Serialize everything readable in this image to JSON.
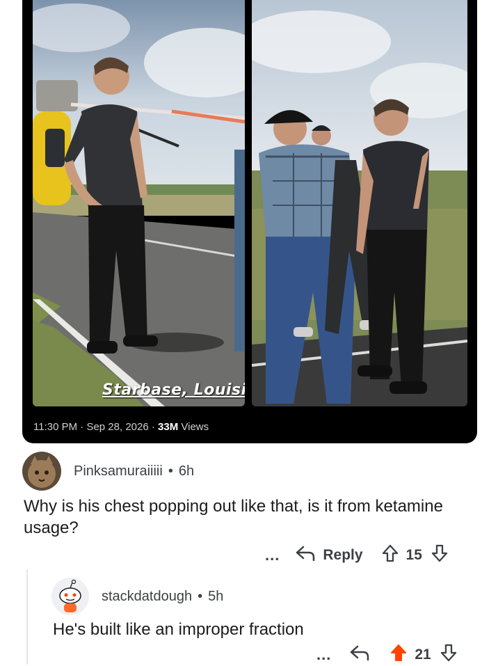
{
  "post": {
    "caption": "Starbase, Louisiana",
    "time": "11:30 PM",
    "sep1": " · ",
    "date": "Sep 28, 2026",
    "sep2": " · ",
    "views_count": "33M",
    "views_label": " Views"
  },
  "comments": [
    {
      "username": "Pinksamuraiiiii",
      "dot": "•",
      "age": "6h",
      "body": "Why is his chest popping out like that, is it from ketamine usage?",
      "more": "...",
      "reply_label": "Reply",
      "votes": "15"
    },
    {
      "username": "stackdatdough",
      "dot": "•",
      "age": "5h",
      "body": "He's built like an improper fraction",
      "more": "...",
      "votes": "21"
    }
  ],
  "colors": {
    "upvote_active": "#ff4500",
    "icon_gray": "#3b3f45",
    "thread_line": "#e4e6e9"
  },
  "icons": [
    "reply-icon",
    "upvote-icon",
    "downvote-icon",
    "more-icon"
  ]
}
